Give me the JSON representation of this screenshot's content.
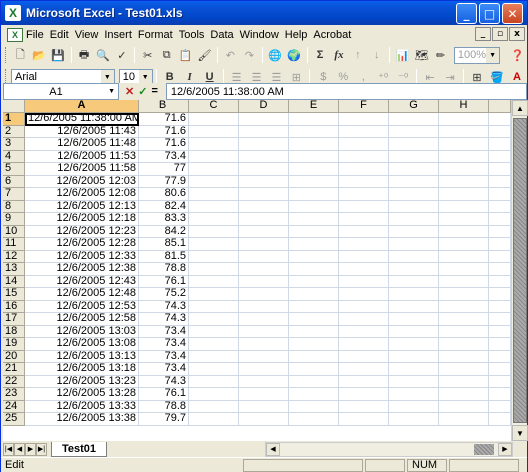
{
  "window": {
    "title": "Microsoft Excel - Test01.xls",
    "app_icon": "excel-icon"
  },
  "title_buttons": {
    "minimize": "_",
    "maximize": "□",
    "close": "✕"
  },
  "menu": {
    "items": [
      "File",
      "Edit",
      "View",
      "Insert",
      "Format",
      "Tools",
      "Data",
      "Window",
      "Help",
      "Acrobat"
    ],
    "doc_buttons": {
      "minimize": "_",
      "restore": "▫",
      "close": "x"
    }
  },
  "standard_toolbar": {
    "zoom": "100%"
  },
  "format_toolbar": {
    "font": "Arial",
    "size": "10",
    "bold": "B",
    "italic": "I",
    "underline": "U",
    "currency": "$",
    "percent": "%"
  },
  "formula_bar": {
    "cell_ref": "A1",
    "cancel": "✕",
    "enter": "✓",
    "equals": "=",
    "content": "12/6/2005  11:38:00 AM"
  },
  "grid": {
    "columns": [
      "A",
      "B",
      "C",
      "D",
      "E",
      "F",
      "G",
      "H"
    ],
    "rows": [
      {
        "n": "1",
        "a": "12/6/2005  11:38:00 AM",
        "b": "71.6"
      },
      {
        "n": "2",
        "a": "12/6/2005 11:43",
        "b": "71.6"
      },
      {
        "n": "3",
        "a": "12/6/2005 11:48",
        "b": "71.6"
      },
      {
        "n": "4",
        "a": "12/6/2005 11:53",
        "b": "73.4"
      },
      {
        "n": "5",
        "a": "12/6/2005 11:58",
        "b": "77"
      },
      {
        "n": "6",
        "a": "12/6/2005 12:03",
        "b": "77.9"
      },
      {
        "n": "7",
        "a": "12/6/2005 12:08",
        "b": "80.6"
      },
      {
        "n": "8",
        "a": "12/6/2005 12:13",
        "b": "82.4"
      },
      {
        "n": "9",
        "a": "12/6/2005 12:18",
        "b": "83.3"
      },
      {
        "n": "10",
        "a": "12/6/2005 12:23",
        "b": "84.2"
      },
      {
        "n": "11",
        "a": "12/6/2005 12:28",
        "b": "85.1"
      },
      {
        "n": "12",
        "a": "12/6/2005 12:33",
        "b": "81.5"
      },
      {
        "n": "13",
        "a": "12/6/2005 12:38",
        "b": "78.8"
      },
      {
        "n": "14",
        "a": "12/6/2005 12:43",
        "b": "76.1"
      },
      {
        "n": "15",
        "a": "12/6/2005 12:48",
        "b": "75.2"
      },
      {
        "n": "16",
        "a": "12/6/2005 12:53",
        "b": "74.3"
      },
      {
        "n": "17",
        "a": "12/6/2005 12:58",
        "b": "74.3"
      },
      {
        "n": "18",
        "a": "12/6/2005 13:03",
        "b": "73.4"
      },
      {
        "n": "19",
        "a": "12/6/2005 13:08",
        "b": "73.4"
      },
      {
        "n": "20",
        "a": "12/6/2005 13:13",
        "b": "73.4"
      },
      {
        "n": "21",
        "a": "12/6/2005 13:18",
        "b": "73.4"
      },
      {
        "n": "22",
        "a": "12/6/2005 13:23",
        "b": "74.3"
      },
      {
        "n": "23",
        "a": "12/6/2005 13:28",
        "b": "76.1"
      },
      {
        "n": "24",
        "a": "12/6/2005 13:33",
        "b": "78.8"
      },
      {
        "n": "25",
        "a": "12/6/2005 13:38",
        "b": "79.7"
      }
    ],
    "selected_cell": "A1"
  },
  "sheets": {
    "tabs": [
      "Test01"
    ],
    "active": "Test01"
  },
  "status": {
    "mode": "Edit",
    "num": "NUM"
  },
  "colors": {
    "title_bar": "#0A5FEA",
    "chrome": "#ECE9D8",
    "selection_header": "#f7c97a"
  }
}
